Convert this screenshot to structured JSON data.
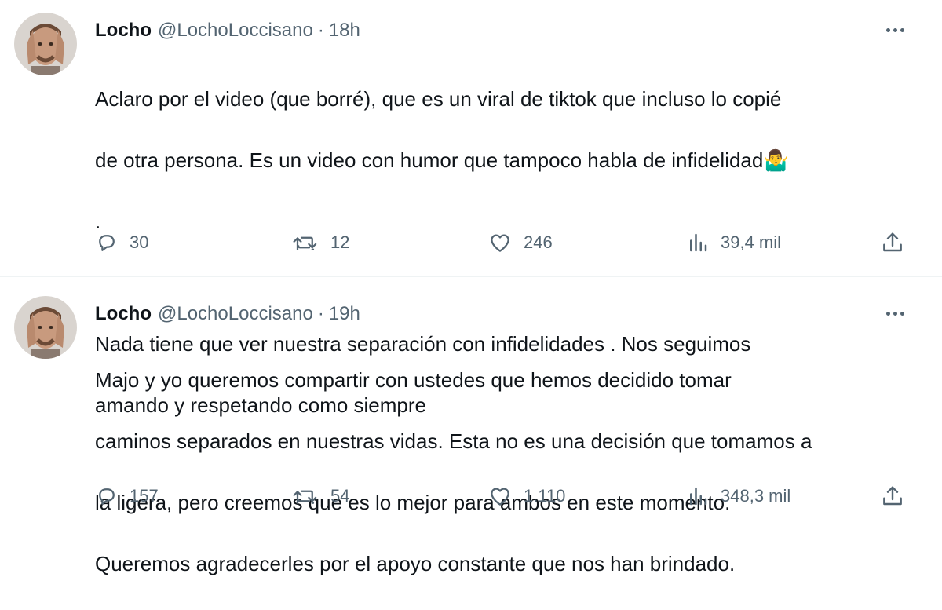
{
  "tweets": [
    {
      "author_name": "Locho",
      "handle": "@LochoLoccisano",
      "separator": "·",
      "time": "18h",
      "text_lines": [
        "Aclaro por el video (que borré), que es un viral de tiktok que incluso lo copié",
        "de otra persona. Es un video con humor que tampoco habla de infidelidad🤷‍♂️",
        ".",
        "",
        "Nada tiene que ver nuestra separación con infidelidades . Nos seguimos",
        "amando y respetando como siempre"
      ],
      "replies": "30",
      "retweets": "12",
      "likes": "246",
      "views": "39,4 mil"
    },
    {
      "author_name": "Locho",
      "handle": "@LochoLoccisano",
      "separator": "·",
      "time": "19h",
      "text_lines": [
        "Majo y yo queremos compartir con ustedes que hemos decidido tomar",
        "caminos separados en nuestras vidas. Esta no es una decisión que tomamos a",
        "la ligera, pero creemos que es lo mejor para ambos en este momento.",
        "Queremos agradecerles por el apoyo constante que nos han brindado."
      ],
      "replies": "157",
      "retweets": "54",
      "likes": "1.110",
      "views": "348,3 mil"
    }
  ],
  "icons": {
    "reply": "reply-icon",
    "retweet": "retweet-icon",
    "like": "heart-icon",
    "views": "views-icon",
    "share": "share-icon",
    "more": "more-icon"
  },
  "colors": {
    "text": "#0f1419",
    "secondary": "#536471",
    "divider": "#eff3f4"
  }
}
